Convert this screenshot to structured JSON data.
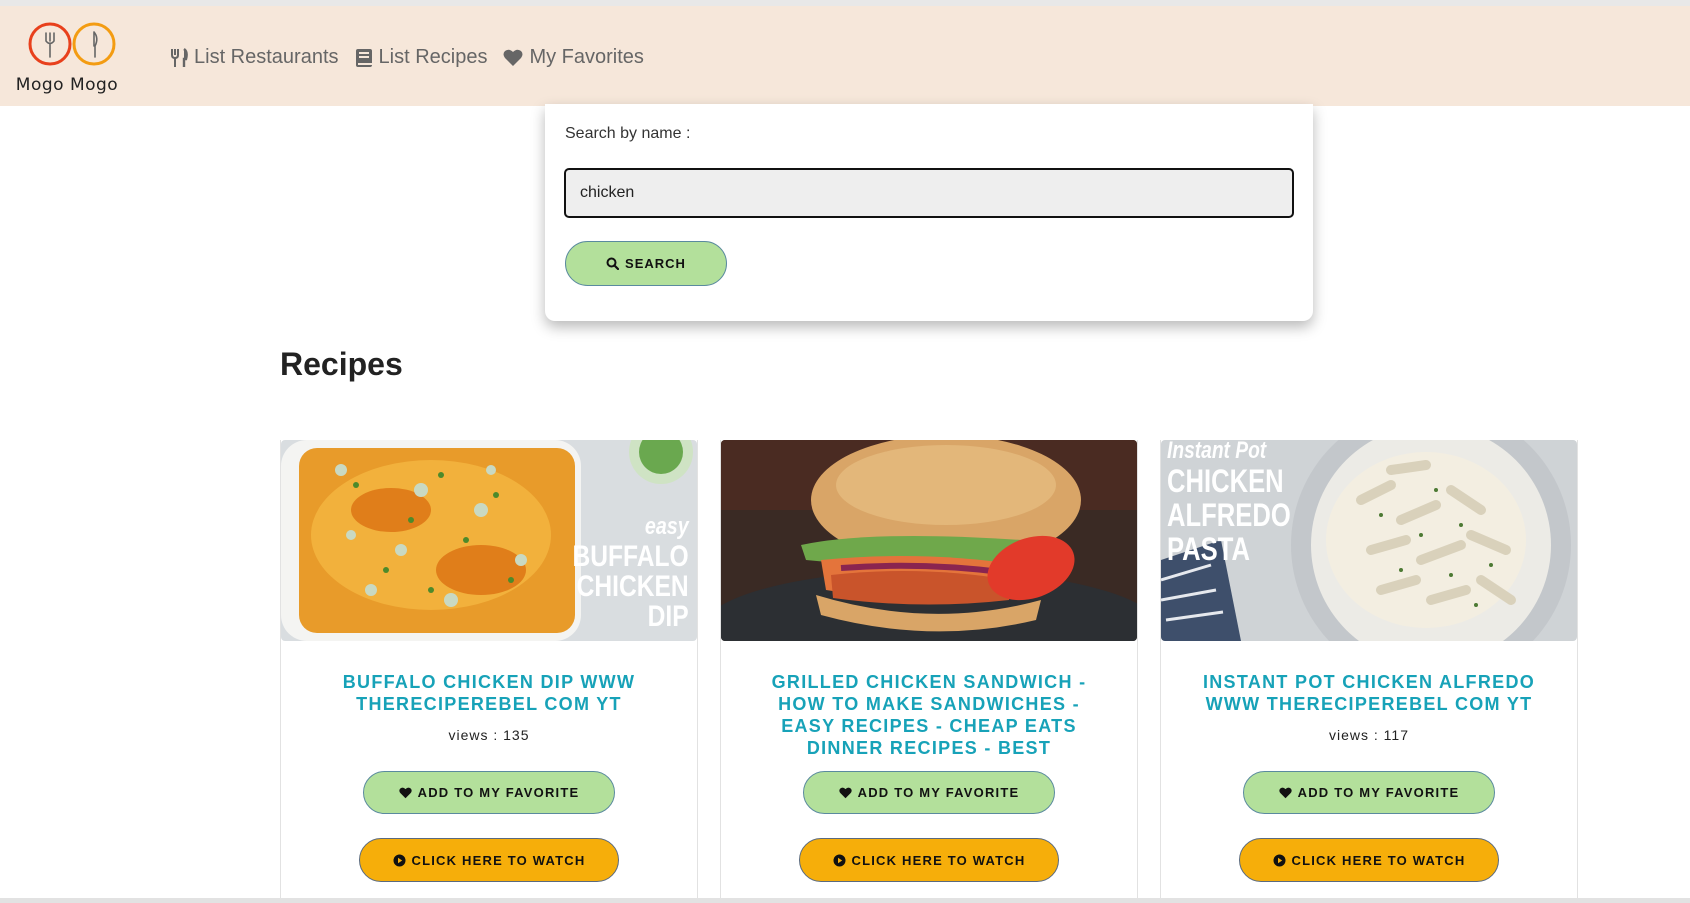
{
  "brand": {
    "name": "Mogo Mogo",
    "ring_color_left": "#e8401c",
    "ring_color_right": "#f39c12"
  },
  "nav": {
    "items": [
      {
        "label": "List Restaurants",
        "icon": "cutlery-icon"
      },
      {
        "label": "List Recipes",
        "icon": "book-icon"
      },
      {
        "label": "My Favorites",
        "icon": "heart-icon"
      }
    ]
  },
  "search": {
    "label": "Search by name :",
    "value": "chicken",
    "button_label": "SEARCH",
    "button_icon": "search-icon"
  },
  "recipes": {
    "heading": "Recipes",
    "items": [
      {
        "title": "BUFFALO CHICKEN DIP WWW THERECIPEREBEL COM YT",
        "views": "views : 135",
        "image_caption": [
          "easy",
          "BUFFALO",
          "CHICKEN",
          "DIP"
        ],
        "fav_label": "ADD TO MY FAVORITE",
        "watch_label": "CLICK HERE TO WATCH"
      },
      {
        "title": "GRILLED CHICKEN SANDWICH - HOW TO MAKE SANDWICHES - EASY RECIPES - CHEAP EATS DINNER RECIPES - BEST",
        "views": "",
        "image_caption": [],
        "fav_label": "ADD TO MY FAVORITE",
        "watch_label": "CLICK HERE TO WATCH"
      },
      {
        "title": "INSTANT POT CHICKEN ALFREDO WWW THERECIPEREBEL COM YT",
        "views": "views : 117",
        "image_caption": [
          "Instant Pot",
          "CHICKEN",
          "ALFREDO",
          "PASTA"
        ],
        "fav_label": "ADD TO MY FAVORITE",
        "watch_label": "CLICK HERE TO WATCH"
      }
    ]
  },
  "colors": {
    "navbar_bg": "#f6e7da",
    "title_accent": "#17a2b8",
    "green_button": "#b3e09b",
    "orange_button": "#f6ae0a"
  }
}
